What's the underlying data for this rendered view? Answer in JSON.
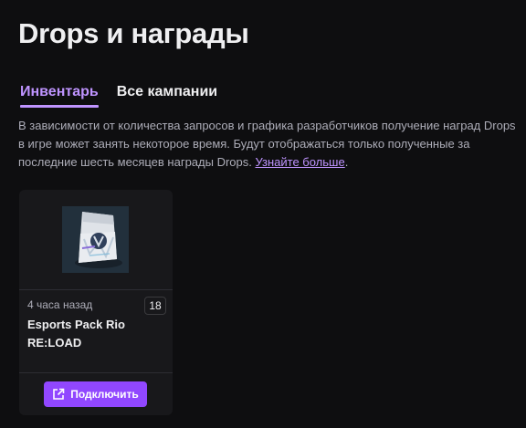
{
  "page": {
    "title": "Drops и награды"
  },
  "tabs": [
    {
      "label": "Инвентарь",
      "active": true
    },
    {
      "label": "Все кампании",
      "active": false
    }
  ],
  "description": {
    "text": "В зависимости от количества запросов и графика разработчиков получение наград Drops в игре может занять некоторое время. Будут отображаться только полученные за последние шесть месяцев награды Drops. ",
    "link_label": "Узнайте больше",
    "trailing": "."
  },
  "reward_card": {
    "time_ago": "4 часа назад",
    "count": "18",
    "name": "Esports Pack Rio RE:LOAD",
    "connect_label": "Подключить",
    "image_icon": "sticker-pack-image"
  },
  "colors": {
    "background": "#0e0e10",
    "accent": "#bf94ff",
    "button": "#9147ff",
    "card": "#18181b"
  }
}
